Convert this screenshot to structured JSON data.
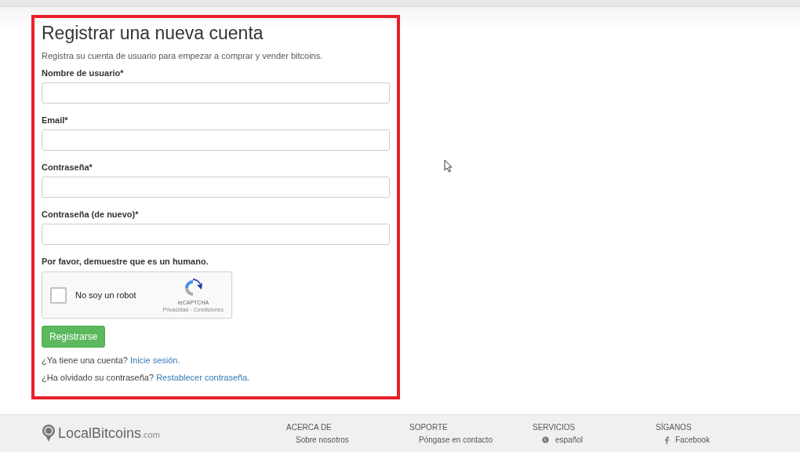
{
  "form": {
    "title": "Registrar una nueva cuenta",
    "subtitle": "Registra su cuenta de usuario para empezar a comprar y vender bitcoins.",
    "fields": [
      {
        "label": "Nombre de usuario*"
      },
      {
        "label": "Email*"
      },
      {
        "label": "Contraseña*"
      },
      {
        "label": "Contraseña (de nuevo)*"
      }
    ],
    "captcha": {
      "prompt": "Por favor, demuestre que es un humano.",
      "label": "No soy un robot",
      "checked": false,
      "brand": "reCAPTCHA",
      "terms": "Privacidad - Condiciones"
    },
    "submit": "Registrarse",
    "links": [
      {
        "text": "¿Ya tiene una cuenta?",
        "link": "Inicie sesión."
      },
      {
        "text": "¿Ha olvidado su contraseña?",
        "link": "Restablecer contraseña."
      }
    ]
  },
  "footer": {
    "logo": {
      "name": "LocalBitcoins",
      "suffix": ".com"
    },
    "columns": [
      {
        "heading": "ACERCA DE",
        "item": "Sobre nosotros"
      },
      {
        "heading": "SOPORTE",
        "item": "Póngase en contacto"
      },
      {
        "heading": "SERVICIOS",
        "item": "español"
      },
      {
        "heading": "SÍGANOS",
        "item": "Facebook"
      }
    ]
  }
}
